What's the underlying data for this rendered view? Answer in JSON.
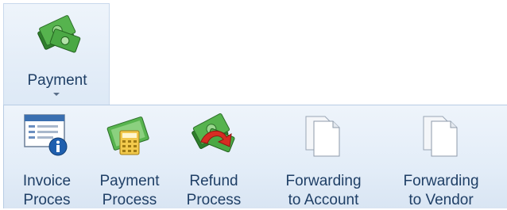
{
  "ribbon": {
    "payment_button": {
      "label": "Payment",
      "icon": "money-stack-icon"
    }
  },
  "menu": {
    "items": [
      {
        "line1": "Invoice",
        "line2": "Proces",
        "icon": "invoice-icon"
      },
      {
        "line1": "Payment",
        "line2": "Process",
        "icon": "payment-calculator-icon"
      },
      {
        "line1": "Refund",
        "line2": "Process",
        "icon": "refund-icon"
      },
      {
        "line1": "Forwarding",
        "line2": "to Account",
        "icon": "document-forward-icon"
      },
      {
        "line1": "Forwarding",
        "line2": "to Vendor",
        "icon": "document-forward-icon"
      }
    ]
  },
  "colors": {
    "label_text": "#1f3f66",
    "money_green": "#3f9e3c",
    "refund_arrow": "#d62c23"
  }
}
